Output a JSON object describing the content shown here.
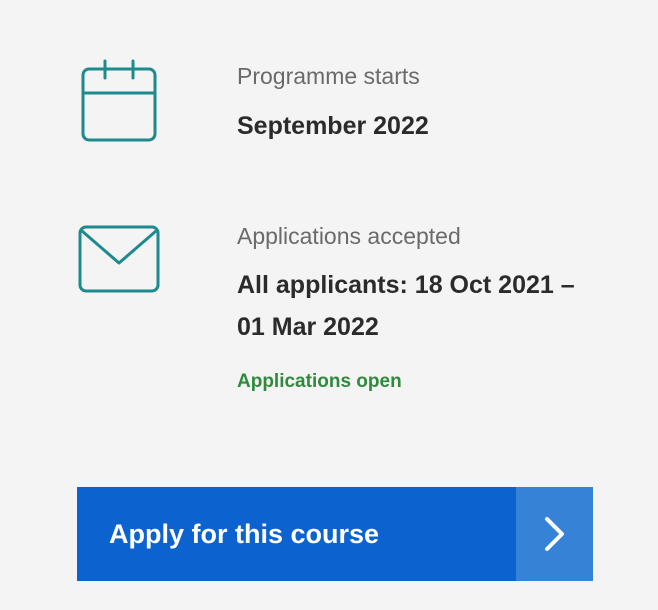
{
  "programme": {
    "icon": "calendar-icon",
    "label": "Programme starts",
    "value": "September 2022"
  },
  "applications": {
    "icon": "envelope-icon",
    "label": "Applications accepted",
    "value_line1": "All applicants: 18 Oct 2021 –",
    "value_line2": "01 Mar 2022",
    "status": "Applications open"
  },
  "apply": {
    "label": "Apply for this course",
    "icon": "chevron-right-icon"
  },
  "colors": {
    "background": "#f4f4f5",
    "icon_teal": "#1e8a8e",
    "button_blue": "#0c63d0",
    "button_arrow_blue": "#3682d6",
    "status_green": "#2f8a3d"
  }
}
